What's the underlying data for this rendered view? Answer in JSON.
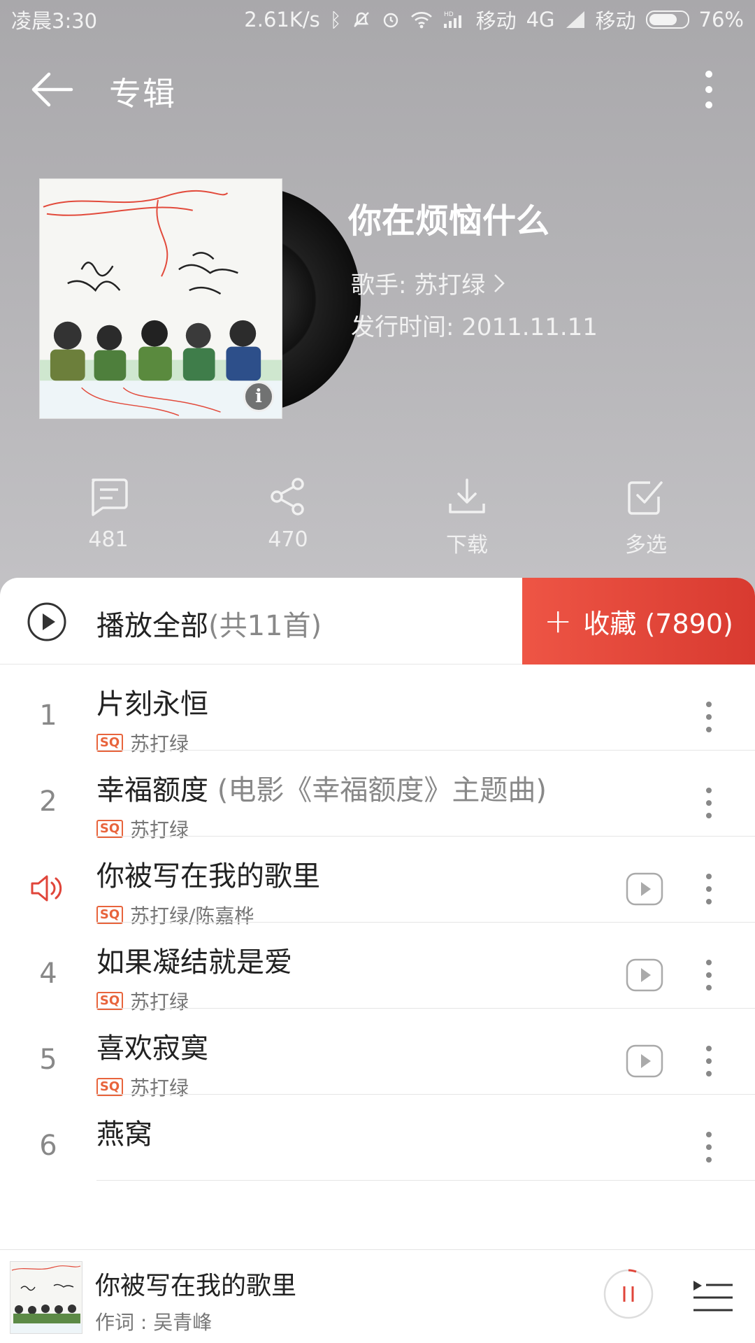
{
  "status_bar": {
    "time": "凌晨3:30",
    "net_speed": "2.61K/s",
    "carrier1": "移动",
    "network": "4G",
    "carrier2": "移动",
    "battery": "76%"
  },
  "app_bar": {
    "title": "专辑"
  },
  "album": {
    "title": "你在烦恼什么",
    "artist_label": "歌手: 苏打绿",
    "release_label": "发行时间: 2011.11.11"
  },
  "actions": {
    "comments": "481",
    "share": "470",
    "download": "下载",
    "multiselect": "多选"
  },
  "play_all": {
    "label": "播放全部",
    "count": "(共11首)",
    "collect_label": "收藏 (7890)"
  },
  "tracks": [
    {
      "num": "1",
      "title": "片刻永恒",
      "subtitle": "",
      "artist": "苏打绿",
      "playing": false,
      "has_mv": false
    },
    {
      "num": "2",
      "title": "幸福额度",
      "subtitle": " (电影《幸福额度》主题曲)",
      "artist": "苏打绿",
      "playing": false,
      "has_mv": false
    },
    {
      "num": "3",
      "title": "你被写在我的歌里",
      "subtitle": "",
      "artist": "苏打绿/陈嘉桦",
      "playing": true,
      "has_mv": true
    },
    {
      "num": "4",
      "title": "如果凝结就是爱",
      "subtitle": "",
      "artist": "苏打绿",
      "playing": false,
      "has_mv": true
    },
    {
      "num": "5",
      "title": "喜欢寂寞",
      "subtitle": "",
      "artist": "苏打绿",
      "playing": false,
      "has_mv": true
    },
    {
      "num": "6",
      "title": "燕窝",
      "subtitle": "",
      "artist": "",
      "playing": false,
      "has_mv": false
    }
  ],
  "quality_badge": "SQ",
  "player": {
    "song": "你被写在我的歌里",
    "lyric": "作词 : 吴青峰"
  },
  "colors": {
    "accent": "#e0453a",
    "header_bg": "#b2b1b4",
    "sq_badge": "#e8643c"
  },
  "icons": [
    "back-arrow-icon",
    "more-vertical-icon",
    "comment-icon",
    "share-icon",
    "download-icon",
    "checkbox-icon",
    "play-circle-icon",
    "speaker-icon",
    "mv-play-icon",
    "pause-icon",
    "queue-icon",
    "info-icon"
  ]
}
